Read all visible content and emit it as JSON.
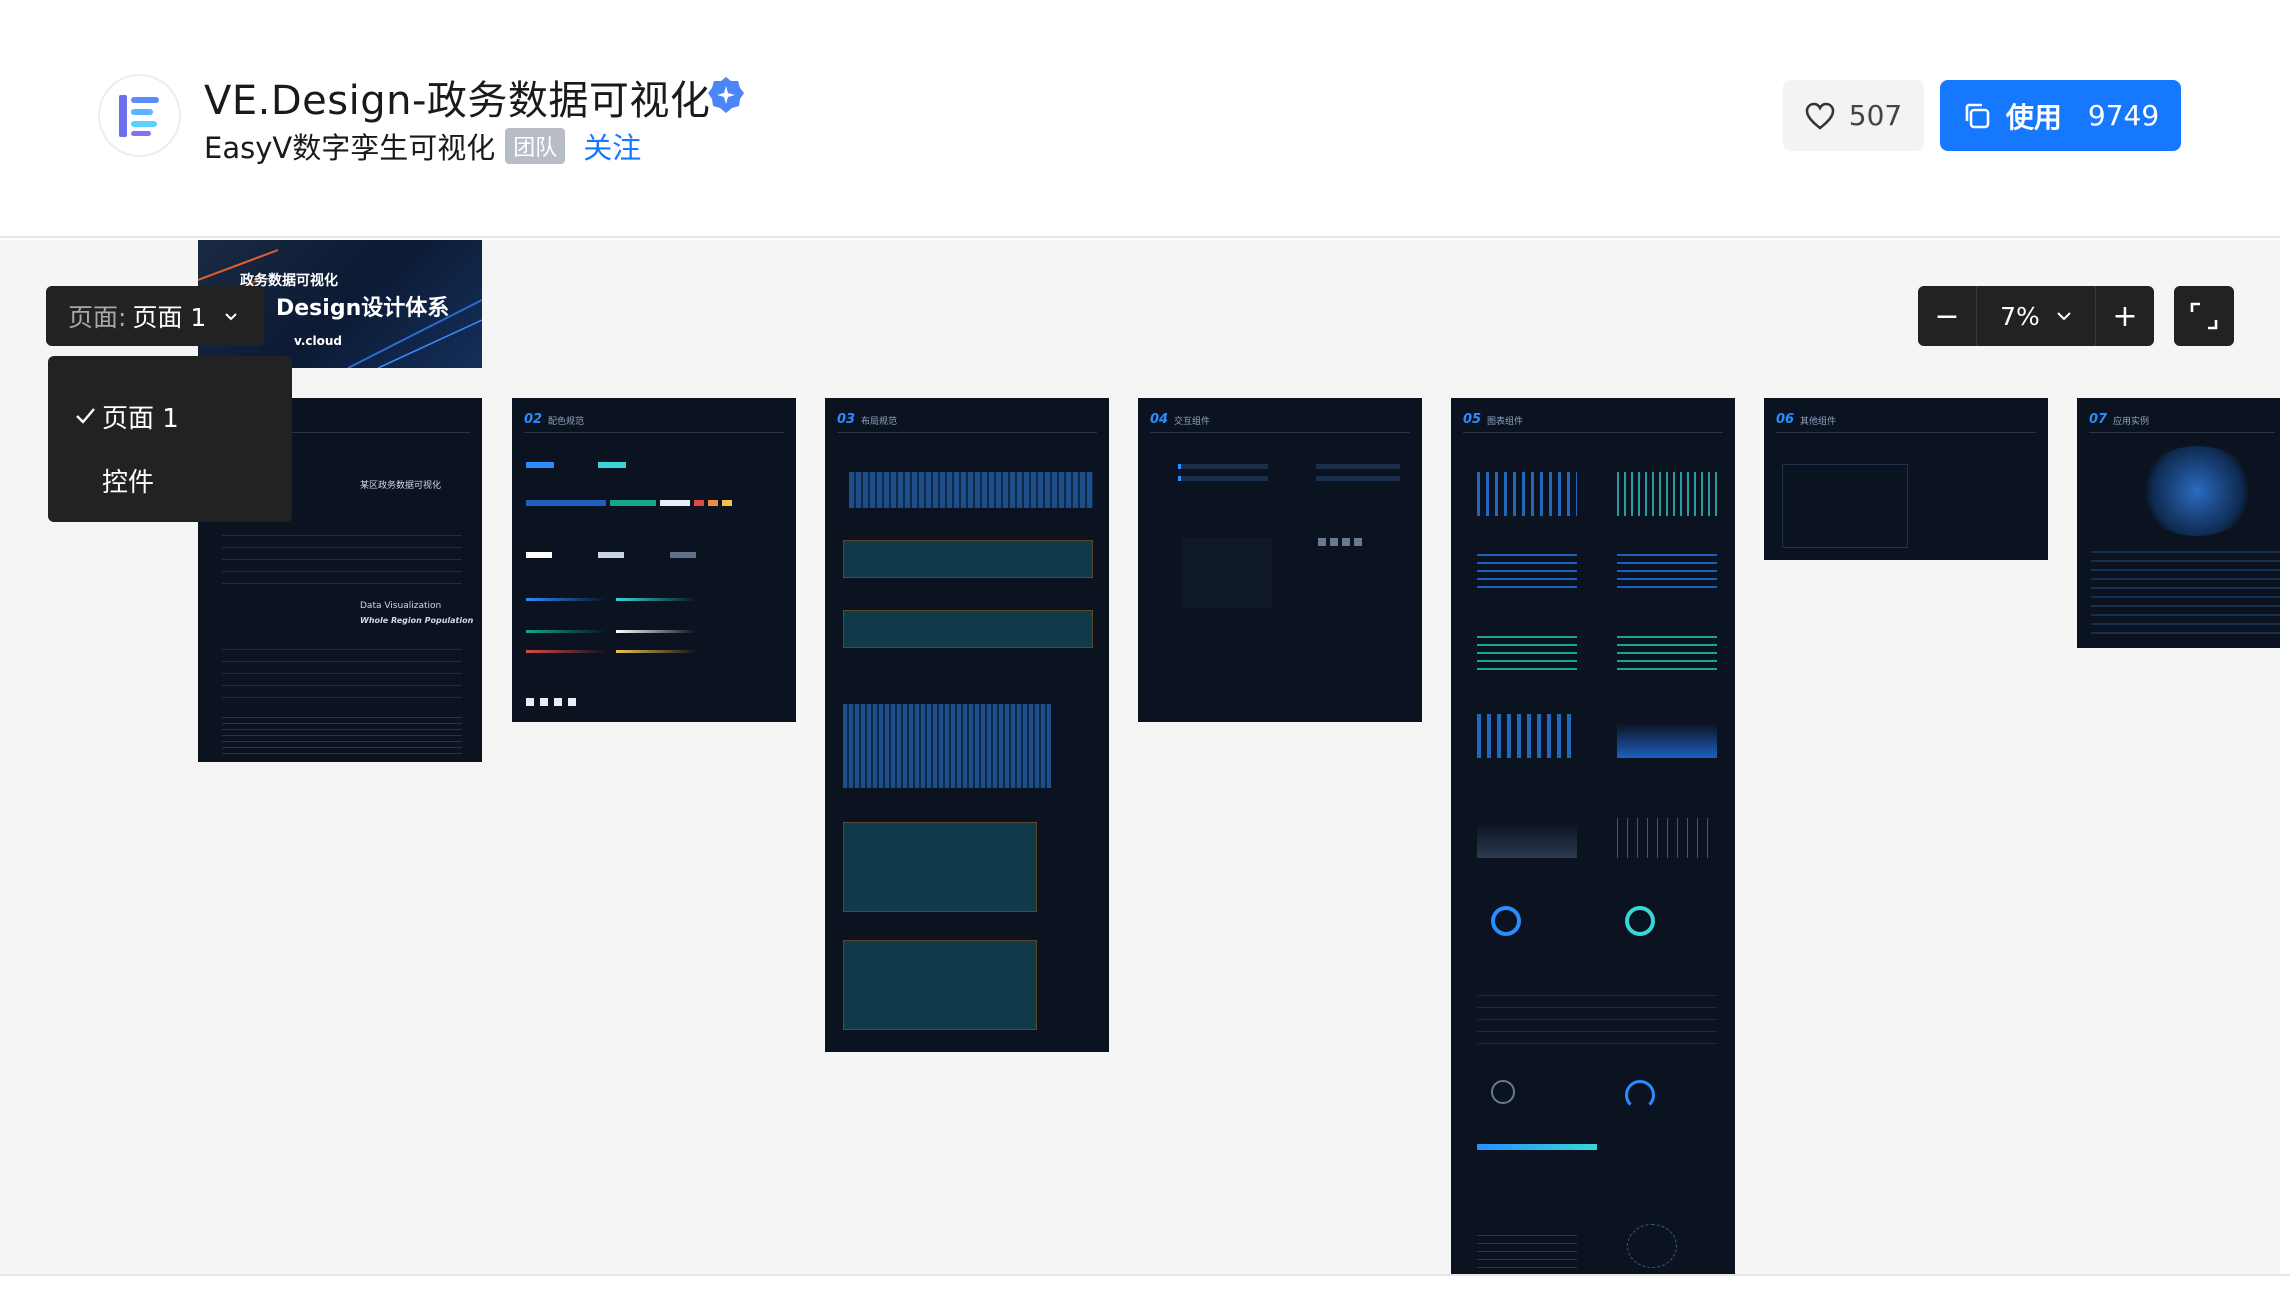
{
  "header": {
    "title": "VE.Design-政务数据可视化",
    "org_name": "EasyV数字孪生可视化",
    "team_badge": "团队",
    "follow_label": "关注",
    "like_count": "507",
    "use_label": "使用",
    "use_count": "9749",
    "accent_color": "#1677ff"
  },
  "page_selector": {
    "label": "页面:",
    "current": "页面 1",
    "options": [
      {
        "label": "页面 1",
        "selected": true
      },
      {
        "label": "控件",
        "selected": false
      }
    ]
  },
  "zoom": {
    "minus": "−",
    "value": "7%",
    "plus": "+"
  },
  "boards": [
    {
      "num": "",
      "title": "",
      "cover_line1": "政务数据可视化",
      "cover_line2": "Design设计体系",
      "cover_line3": "v.cloud"
    },
    {
      "num": "",
      "title": "",
      "text_a": "某区政务数据可视化",
      "text_b": "Data Visualization",
      "text_c": "Whole Region Population"
    },
    {
      "num": "02",
      "title": "配色规范"
    },
    {
      "num": "03",
      "title": "布局规范"
    },
    {
      "num": "04",
      "title": "交互组件"
    },
    {
      "num": "05",
      "title": "图表组件"
    },
    {
      "num": "06",
      "title": "其他组件"
    },
    {
      "num": "07",
      "title": "应用实例"
    }
  ]
}
